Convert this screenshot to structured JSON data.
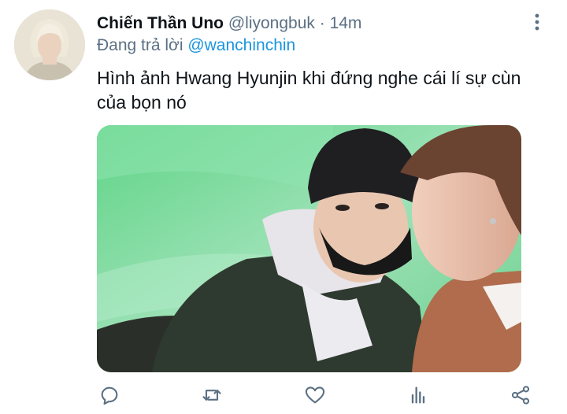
{
  "tweet": {
    "display_name": "Chiến Thần Uno",
    "handle": "@liyongbuk",
    "separator": "·",
    "time": "14m",
    "reply_prefix": "Đang trả lời",
    "reply_to": "@wanchinchin",
    "text": "Hình ảnh Hwang Hyunjin khi đứng nghe cái lí sự cùn của bọn nó"
  },
  "icons": {
    "more": "more-vertical-icon",
    "reply": "reply-icon",
    "retweet": "retweet-icon",
    "like": "heart-icon",
    "analytics": "analytics-icon",
    "share": "share-icon"
  },
  "colors": {
    "secondary_text": "#5b7083",
    "mention": "#1b95e0",
    "icon": "#5b7083",
    "primary_text": "#0f1419"
  }
}
